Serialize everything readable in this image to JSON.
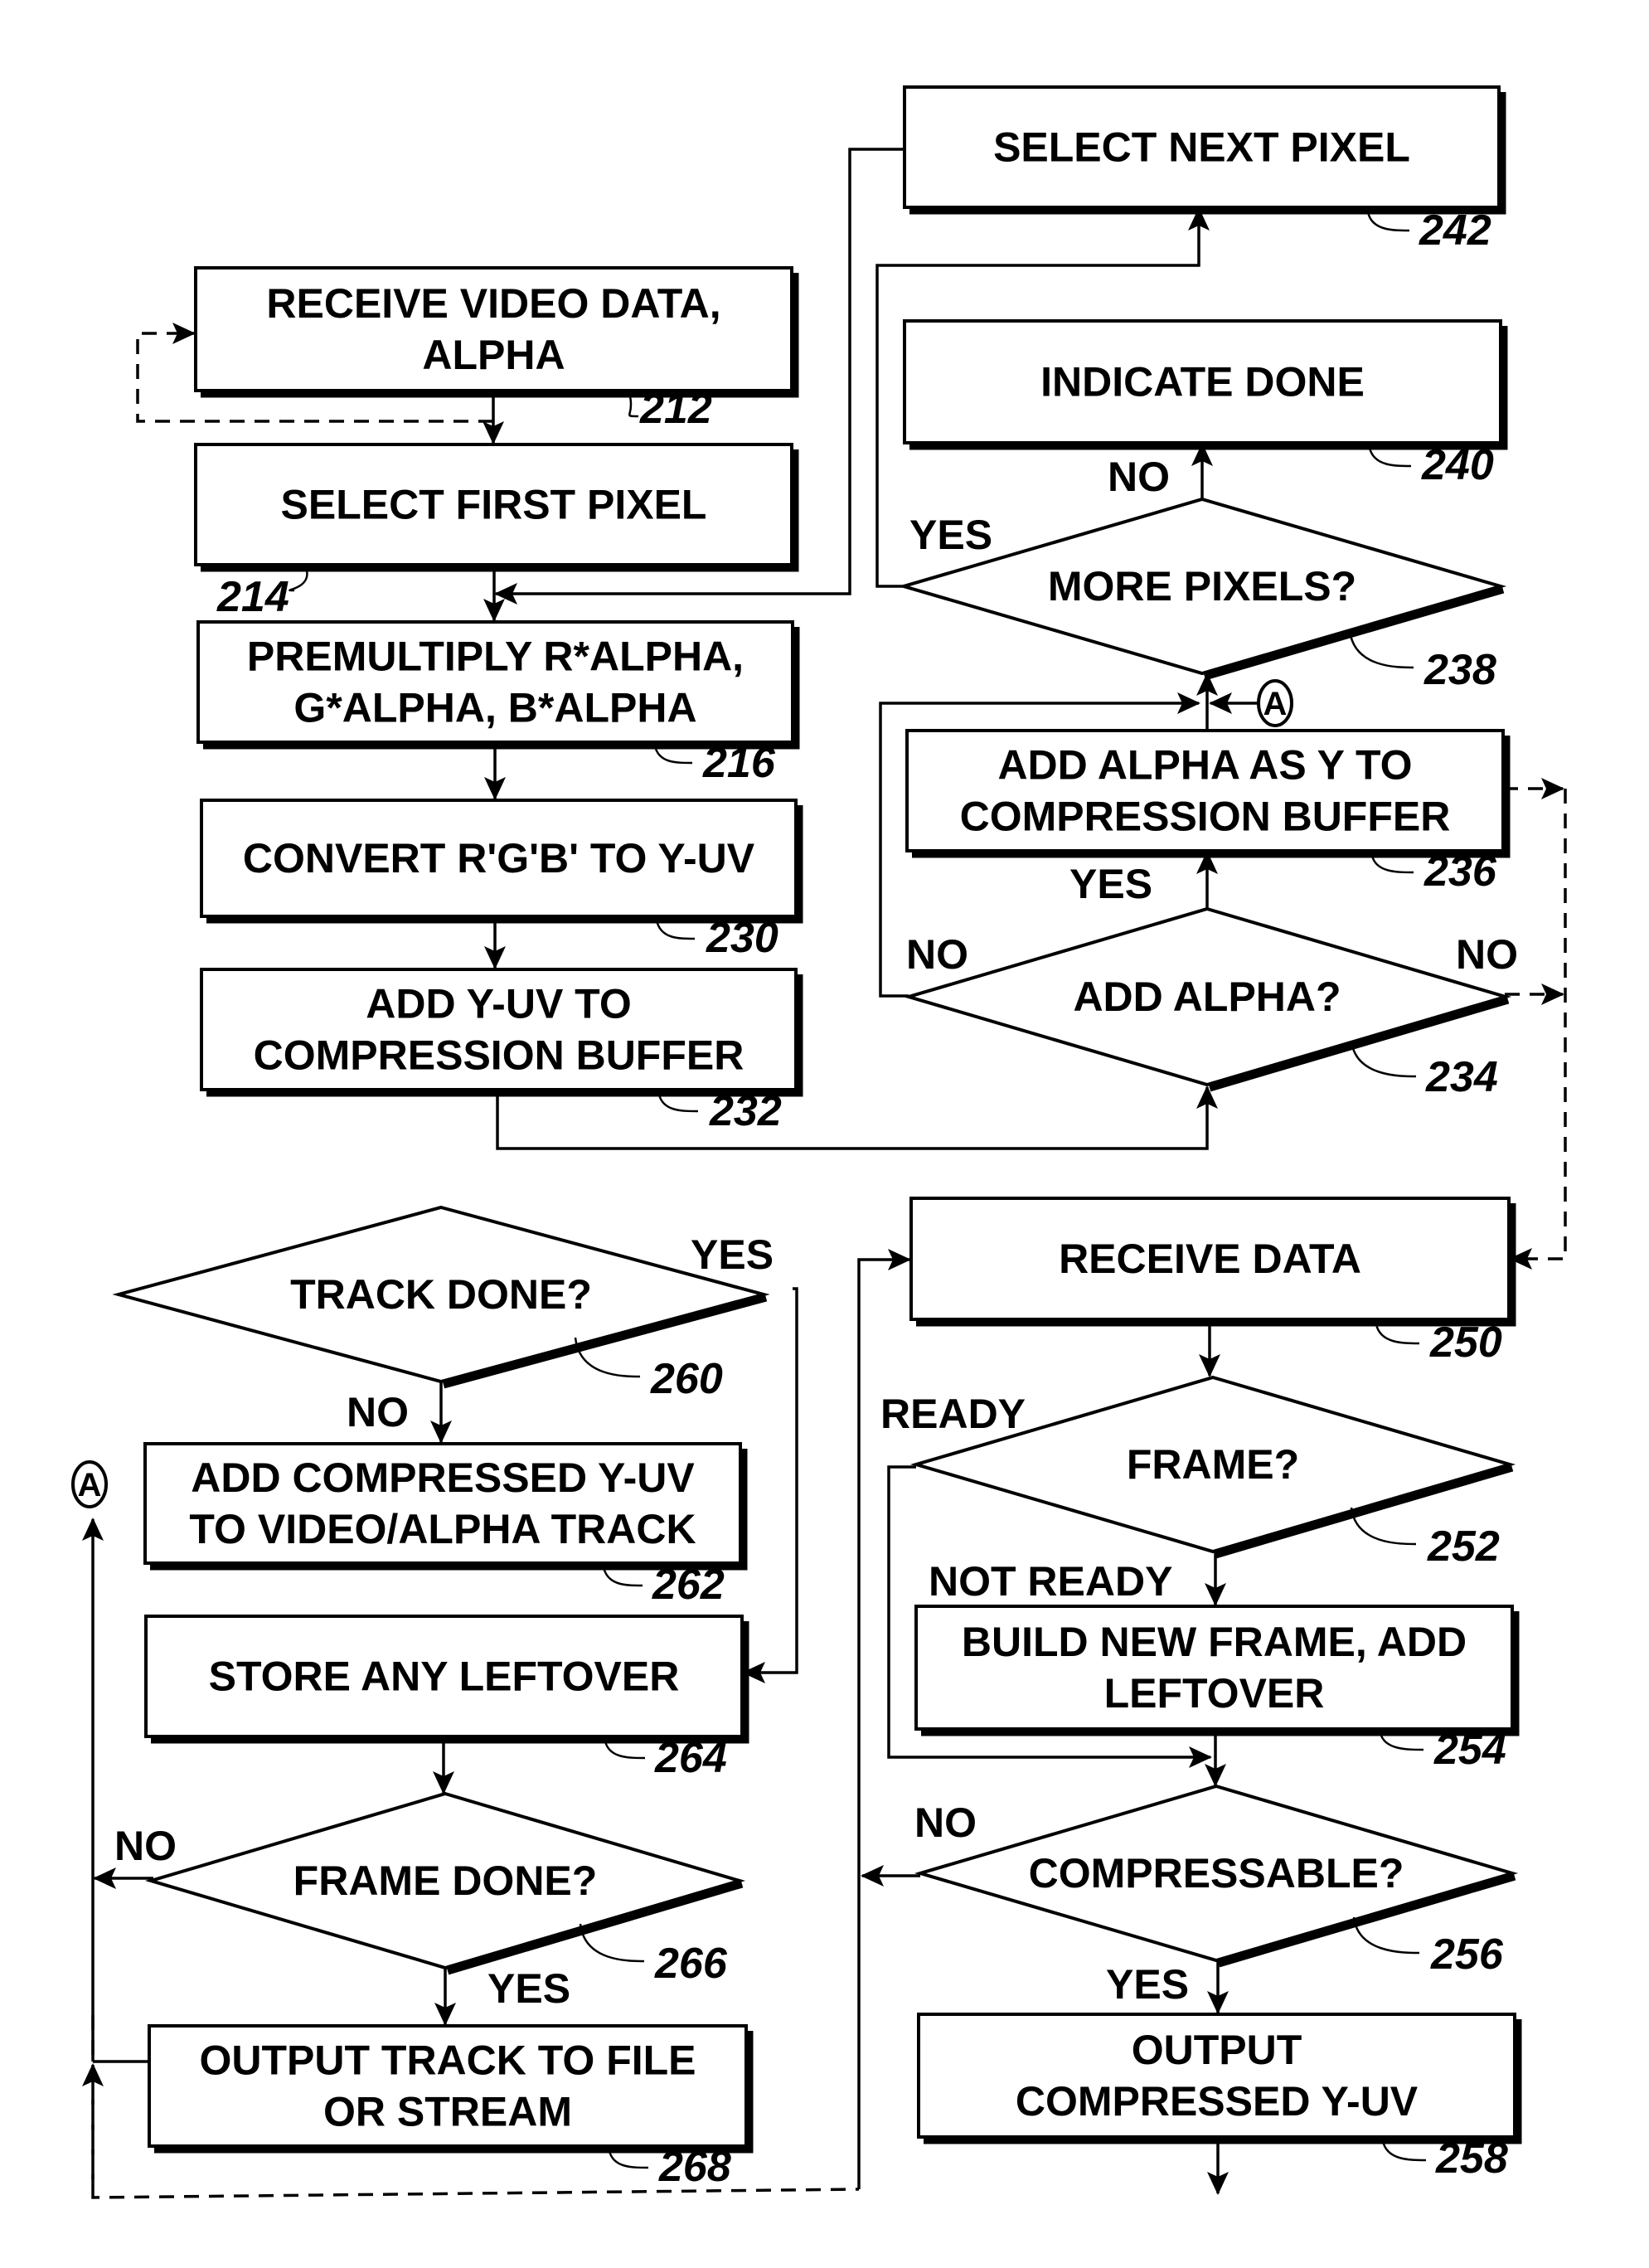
{
  "nodes": {
    "n212": {
      "lines": [
        "RECEIVE VIDEO DATA,",
        "ALPHA"
      ],
      "ref": "212"
    },
    "n214": {
      "lines": [
        "SELECT FIRST PIXEL"
      ],
      "ref": "214"
    },
    "n216": {
      "lines": [
        "PREMULTIPLY R*ALPHA,",
        "G*ALPHA, B*ALPHA"
      ],
      "ref": "216"
    },
    "n230": {
      "lines": [
        "CONVERT R'G'B' TO Y-UV"
      ],
      "ref": "230"
    },
    "n232": {
      "lines": [
        "ADD Y-UV TO",
        "COMPRESSION BUFFER"
      ],
      "ref": "232"
    },
    "n234": {
      "lines": [
        "ADD ALPHA?"
      ],
      "ref": "234"
    },
    "n236": {
      "lines": [
        "ADD ALPHA AS Y TO",
        "COMPRESSION BUFFER"
      ],
      "ref": "236"
    },
    "n238": {
      "lines": [
        "MORE PIXELS?"
      ],
      "ref": "238"
    },
    "n240": {
      "lines": [
        "INDICATE DONE"
      ],
      "ref": "240"
    },
    "n242": {
      "lines": [
        "SELECT NEXT PIXEL"
      ],
      "ref": "242"
    },
    "n250": {
      "lines": [
        "RECEIVE DATA"
      ],
      "ref": "250"
    },
    "n252": {
      "lines": [
        "FRAME?"
      ],
      "ref": "252"
    },
    "n254": {
      "lines": [
        "BUILD NEW FRAME, ADD",
        "LEFTOVER"
      ],
      "ref": "254"
    },
    "n256": {
      "lines": [
        "COMPRESSABLE?"
      ],
      "ref": "256"
    },
    "n258": {
      "lines": [
        "OUTPUT",
        "COMPRESSED Y-UV"
      ],
      "ref": "258"
    },
    "n260": {
      "lines": [
        "TRACK DONE?"
      ],
      "ref": "260"
    },
    "n262": {
      "lines": [
        "ADD COMPRESSED Y-UV",
        "TO VIDEO/ALPHA TRACK"
      ],
      "ref": "262"
    },
    "n264": {
      "lines": [
        "STORE ANY LEFTOVER"
      ],
      "ref": "264"
    },
    "n266": {
      "lines": [
        "FRAME DONE?"
      ],
      "ref": "266"
    },
    "n268": {
      "lines": [
        "OUTPUT TRACK TO FILE",
        "OR STREAM"
      ],
      "ref": "268"
    }
  },
  "edge_labels": {
    "l238_no": "NO",
    "l238_yes": "YES",
    "l234_yes": "YES",
    "l234_no_left": "NO",
    "l234_no_right": "NO",
    "l260_yes": "YES",
    "l260_no": "NO",
    "l252_ready": "READY",
    "l252_not_ready": "NOT READY",
    "l256_no": "NO",
    "l256_yes": "YES",
    "l266_no": "NO",
    "l266_yes": "YES"
  },
  "connectors": {
    "a_top": "A",
    "a_left": "A"
  }
}
